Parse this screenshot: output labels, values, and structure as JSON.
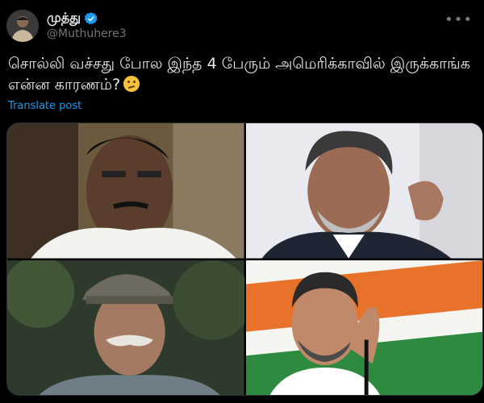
{
  "tweet": {
    "display_name": "முத்து",
    "handle": "@Muthuhere3",
    "text": "சொல்லி வச்சது போல இந்த 4 பேரும் அமெரிக்காவில் இருக்காங்க என்ன காரணம்?",
    "emoji": "thinking-face",
    "translate_label": "Translate post",
    "more_icon": "ellipsis-icon",
    "verified_icon": "verified-badge-icon"
  },
  "media": {
    "count": 4,
    "photos": [
      {
        "position": "top-left"
      },
      {
        "position": "top-right"
      },
      {
        "position": "bottom-left"
      },
      {
        "position": "bottom-right"
      }
    ]
  },
  "colors": {
    "background": "#000000",
    "text": "#e7e9ea",
    "secondary": "#71767b",
    "link": "#1d9bf0"
  }
}
